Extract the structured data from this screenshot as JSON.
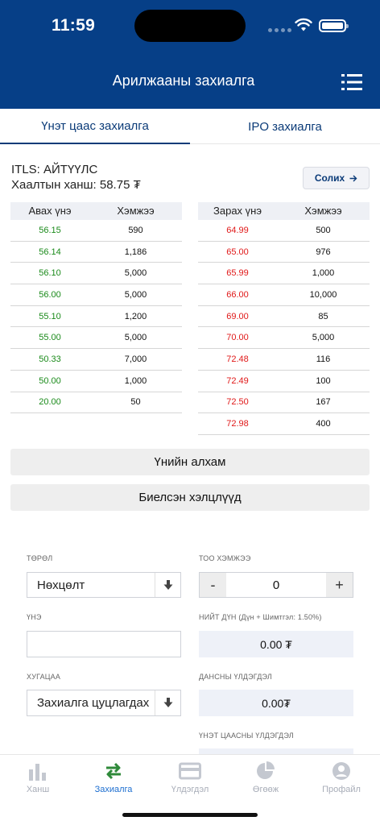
{
  "status_bar": {
    "time": "11:59"
  },
  "header": {
    "title": "Арилжааны захиалга",
    "menu_icon": "list-menu-icon"
  },
  "tabs": [
    {
      "label": "Үнэт цаас захиалга",
      "active": true
    },
    {
      "label": "IPO захиалга",
      "active": false
    }
  ],
  "stock": {
    "name": "ITLS: АЙТҮҮЛС",
    "close_price": "Хаалтын ханш: 58.75 ₮",
    "change_button": "Солих"
  },
  "bids": {
    "headers": [
      "Авах үнэ",
      "Хэмжээ"
    ],
    "rows": [
      [
        "56.15",
        "590"
      ],
      [
        "56.14",
        "1,186"
      ],
      [
        "56.10",
        "5,000"
      ],
      [
        "56.00",
        "5,000"
      ],
      [
        "55.10",
        "1,200"
      ],
      [
        "55.00",
        "5,000"
      ],
      [
        "50.33",
        "7,000"
      ],
      [
        "50.00",
        "1,000"
      ],
      [
        "20.00",
        "50"
      ]
    ]
  },
  "asks": {
    "headers": [
      "Зарах үнэ",
      "Хэмжээ"
    ],
    "rows": [
      [
        "64.99",
        "500"
      ],
      [
        "65.00",
        "976"
      ],
      [
        "65.99",
        "1,000"
      ],
      [
        "66.00",
        "10,000"
      ],
      [
        "69.00",
        "85"
      ],
      [
        "70.00",
        "5,000"
      ],
      [
        "72.48",
        "116"
      ],
      [
        "72.49",
        "100"
      ],
      [
        "72.50",
        "167"
      ],
      [
        "72.98",
        "400"
      ]
    ]
  },
  "buttons": {
    "price_step": "Үнийн алхам",
    "executed_trades": "Биелсэн хэлцлүүд"
  },
  "form": {
    "type_label": "ТӨРӨЛ",
    "type_value": "Нөхцөлт",
    "quantity_label": "ТОО ХЭМЖЭЭ",
    "quantity_value": "0",
    "minus": "-",
    "plus": "+",
    "price_label": "ҮНЭ",
    "price_value": "",
    "total_label": "НИЙТ ДҮН (Дүн + Шимтгэл: 1.50%)",
    "total_value": "0.00 ₮",
    "duration_label": "ХУГАЦАА",
    "duration_value": "Захиалга цуцлагдах",
    "account_balance_label": "ДАНСНЫ ҮЛДЭГДЭЛ",
    "account_balance_value": "0.00₮",
    "securities_balance_label": "ҮНЭТ ЦААСНЫ ҮЛДЭГДЭЛ"
  },
  "nav": [
    {
      "label": "Ханш",
      "icon": "bar-chart-icon",
      "active": false
    },
    {
      "label": "Захиалга",
      "icon": "swap-arrows-icon",
      "active": true
    },
    {
      "label": "Үлдэгдэл",
      "icon": "card-icon",
      "active": false
    },
    {
      "label": "Өгөөж",
      "icon": "pie-chart-icon",
      "active": false
    },
    {
      "label": "Профайл",
      "icon": "user-icon",
      "active": false
    }
  ],
  "colors": {
    "primary": "#063f87",
    "bid": "#1a8a1a",
    "ask": "#e01818",
    "nav_active": "#1e6fd0",
    "nav_inactive": "#a8adb8"
  }
}
